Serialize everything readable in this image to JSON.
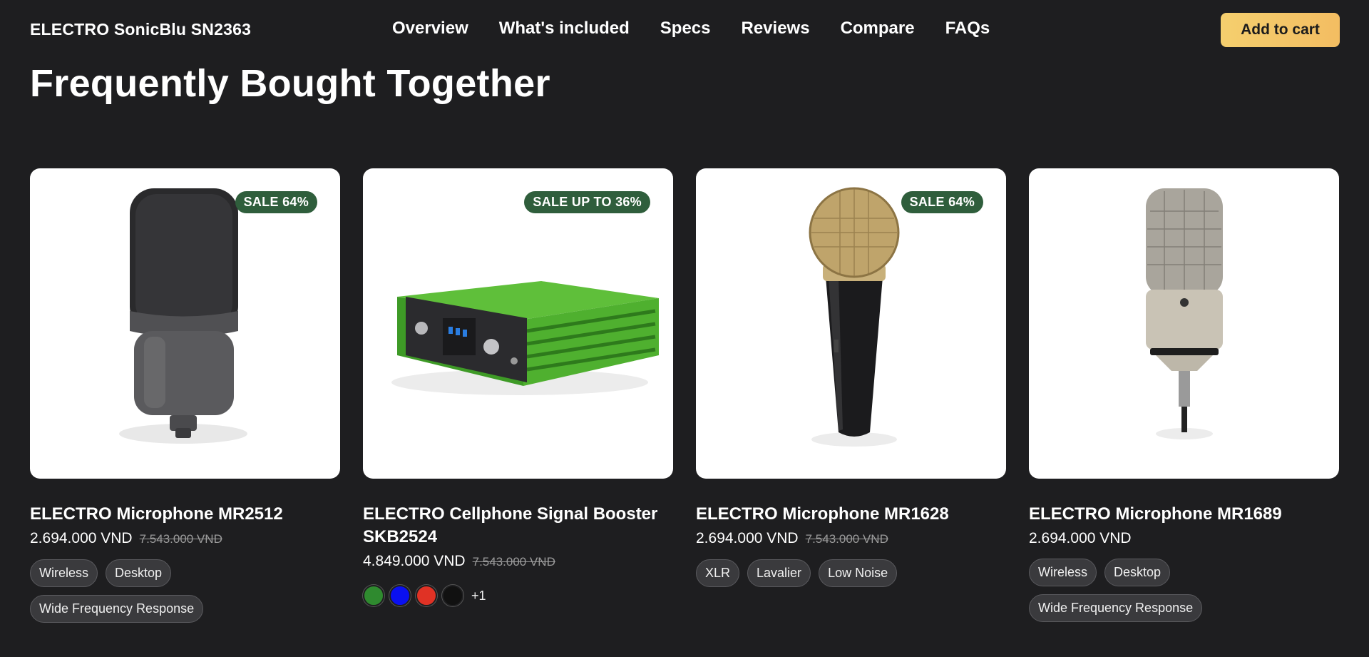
{
  "header": {
    "brand": "ELECTRO SonicBlu SN2363",
    "nav": [
      "Overview",
      "What's included",
      "Specs",
      "Reviews",
      "Compare",
      "FAQs"
    ],
    "cart_label": "Add to cart"
  },
  "section": {
    "title": "Frequently Bought Together"
  },
  "products": [
    {
      "image": "condenser-microphone-dark",
      "sale": "SALE 64%",
      "title": "ELECTRO Microphone MR2512",
      "price": "2.694.000 VND",
      "old_price": "7.543.000 VND",
      "tags": [
        "Wireless",
        "Desktop",
        "Wide Frequency Response"
      ]
    },
    {
      "image": "signal-booster-green",
      "sale": "SALE UP TO 36%",
      "title": "ELECTRO Cellphone Signal Booster SKB2524",
      "price": "4.849.000 VND",
      "old_price": "7.543.000 VND",
      "swatches": [
        "#2f8a2f",
        "#0a10f0",
        "#e03225",
        "#111111"
      ],
      "more_colors": "+1"
    },
    {
      "image": "handheld-microphone-gold",
      "sale": "SALE 64%",
      "title": "ELECTRO Microphone MR1628",
      "price": "2.694.000 VND",
      "old_price": "7.543.000 VND",
      "tags": [
        "XLR",
        "Lavalier",
        "Low Noise"
      ]
    },
    {
      "image": "studio-microphone-silver",
      "sale": "",
      "title": "ELECTRO Microphone MR1689",
      "price": "2.694.000 VND",
      "old_price": "",
      "tags": [
        "Wireless",
        "Desktop",
        "Wide Frequency Response"
      ]
    }
  ]
}
